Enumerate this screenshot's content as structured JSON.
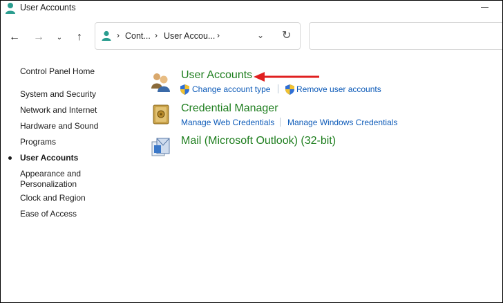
{
  "window": {
    "title": "User Accounts"
  },
  "address": {
    "crumbs": [
      "Cont...",
      "User Accou..."
    ]
  },
  "sidebar": {
    "items": [
      {
        "label": "Control Panel Home"
      },
      {
        "label": "System and Security"
      },
      {
        "label": "Network and Internet"
      },
      {
        "label": "Hardware and Sound"
      },
      {
        "label": "Programs"
      },
      {
        "label": "User Accounts",
        "current": true
      },
      {
        "label": "Appearance and\nPersonalization"
      },
      {
        "label": "Clock and Region"
      },
      {
        "label": "Ease of Access"
      }
    ]
  },
  "categories": [
    {
      "title": "User Accounts",
      "links": [
        "Change account type",
        "Remove user accounts"
      ]
    },
    {
      "title": "Credential Manager",
      "links": [
        "Manage Web Credentials",
        "Manage Windows Credentials"
      ]
    },
    {
      "title": "Mail (Microsoft Outlook) (32-bit)",
      "links": []
    }
  ],
  "colors": {
    "category_title": "#1e7e1e",
    "link": "#0c5ab8",
    "annotation_arrow": "#e02020"
  }
}
